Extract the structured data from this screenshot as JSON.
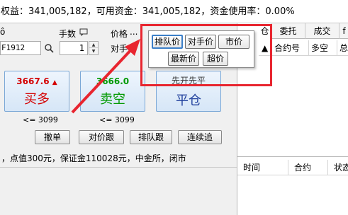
{
  "account": {
    "text": "权益：341,005,182，可用资金：341,005,182，资金使用率：0.00%"
  },
  "order_panel": {
    "contract_icon_partial": "ô",
    "contract_code": "F1912",
    "qty_label": "手数",
    "qty_value": "1",
    "price_label": "价格",
    "price_ellipsis": "...",
    "price_mode": "对手价",
    "buy": {
      "price": "3667.6",
      "label": "买多",
      "limit": "<= 3099",
      "color": "#d40000"
    },
    "sell": {
      "price": "3666.0",
      "label": "卖空",
      "limit": "<= 3099",
      "color": "#009900"
    },
    "close": {
      "price": "先开先平",
      "label": "平仓",
      "color": "#1f3f9c"
    }
  },
  "actions": {
    "cancel": "撤单",
    "follow_counter": "对价跟",
    "follow_queue": "排队跟",
    "chase": "连续追"
  },
  "info_line": "，点值300元，保证金110028元，中金所，闭市",
  "right_panel": {
    "tabs": {
      "partial": "仓",
      "orders": "委托",
      "trades": "成交",
      "more": "f"
    },
    "upper_columns": {
      "order_no": "合约号",
      "direction": "多空",
      "total": "总"
    },
    "lower_columns": {
      "time": "时间",
      "contract": "合约",
      "status": "状态"
    }
  },
  "price_popup": {
    "queue_price": "排队价",
    "counter_price": "对手价",
    "market_price": "市价",
    "last_price": "最新价",
    "over_price": "超价"
  },
  "colors": {
    "highlight": "#e8252f",
    "buy": "#d40000",
    "sell": "#009900",
    "close": "#1f3f9c"
  }
}
